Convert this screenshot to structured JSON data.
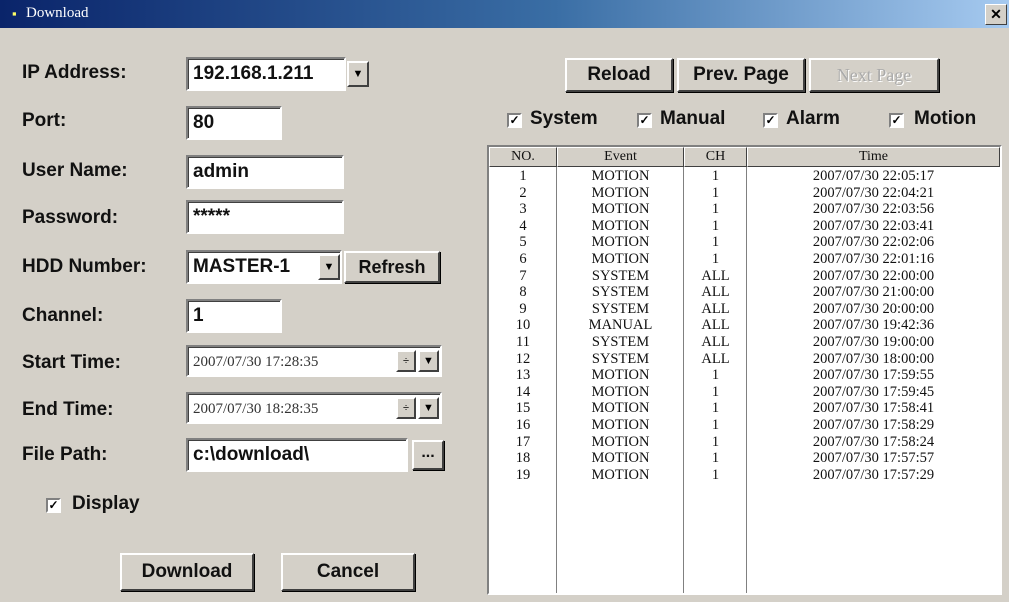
{
  "window": {
    "title": "Download",
    "close_glyph": "✕"
  },
  "form": {
    "ip_label": "IP Address:",
    "ip_value": "192.168.1.211",
    "port_label": "Port:",
    "port_value": "80",
    "user_label": "User Name:",
    "user_value": "admin",
    "password_label": "Password:",
    "password_value": "*****",
    "hdd_label": "HDD Number:",
    "hdd_value": "MASTER-1",
    "refresh_label": "Refresh",
    "channel_label": "Channel:",
    "channel_value": "1",
    "start_label": "Start Time:",
    "start_value": "2007/07/30 17:28:35",
    "end_label": "End Time:",
    "end_value": "2007/07/30 18:28:35",
    "path_label": "File Path:",
    "path_value": "c:\\download\\",
    "browse_label": "...",
    "display_label": "Display",
    "display_checked": true,
    "download_label": "Download",
    "cancel_label": "Cancel"
  },
  "toolbar": {
    "reload_label": "Reload",
    "prev_label": "Prev. Page",
    "next_label": "Next Page",
    "filters": [
      {
        "label": "System",
        "checked": true
      },
      {
        "label": "Manual",
        "checked": true
      },
      {
        "label": "Alarm",
        "checked": true
      },
      {
        "label": "Motion",
        "checked": true
      }
    ]
  },
  "table": {
    "headers": [
      "NO.",
      "Event",
      "CH",
      "Time"
    ],
    "rows": [
      [
        "1",
        "MOTION",
        "1",
        "2007/07/30 22:05:17"
      ],
      [
        "2",
        "MOTION",
        "1",
        "2007/07/30 22:04:21"
      ],
      [
        "3",
        "MOTION",
        "1",
        "2007/07/30 22:03:56"
      ],
      [
        "4",
        "MOTION",
        "1",
        "2007/07/30 22:03:41"
      ],
      [
        "5",
        "MOTION",
        "1",
        "2007/07/30 22:02:06"
      ],
      [
        "6",
        "MOTION",
        "1",
        "2007/07/30 22:01:16"
      ],
      [
        "7",
        "SYSTEM",
        "ALL",
        "2007/07/30 22:00:00"
      ],
      [
        "8",
        "SYSTEM",
        "ALL",
        "2007/07/30 21:00:00"
      ],
      [
        "9",
        "SYSTEM",
        "ALL",
        "2007/07/30 20:00:00"
      ],
      [
        "10",
        "MANUAL",
        "ALL",
        "2007/07/30 19:42:36"
      ],
      [
        "11",
        "SYSTEM",
        "ALL",
        "2007/07/30 19:00:00"
      ],
      [
        "12",
        "SYSTEM",
        "ALL",
        "2007/07/30 18:00:00"
      ],
      [
        "13",
        "MOTION",
        "1",
        "2007/07/30 17:59:55"
      ],
      [
        "14",
        "MOTION",
        "1",
        "2007/07/30 17:59:45"
      ],
      [
        "15",
        "MOTION",
        "1",
        "2007/07/30 17:58:41"
      ],
      [
        "16",
        "MOTION",
        "1",
        "2007/07/30 17:58:29"
      ],
      [
        "17",
        "MOTION",
        "1",
        "2007/07/30 17:58:24"
      ],
      [
        "18",
        "MOTION",
        "1",
        "2007/07/30 17:57:57"
      ],
      [
        "19",
        "MOTION",
        "1",
        "2007/07/30 17:57:29"
      ]
    ]
  }
}
